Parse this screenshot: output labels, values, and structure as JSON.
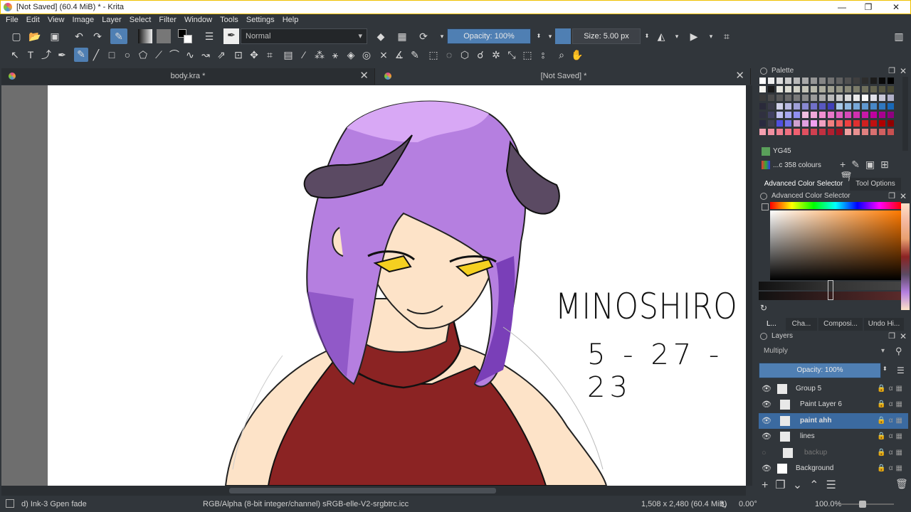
{
  "window": {
    "title": "[Not Saved]  (60.4 MiB)  * - Krita",
    "controls": [
      "—",
      "❐",
      "✕"
    ]
  },
  "menu": [
    {
      "label": "File",
      "u": "F"
    },
    {
      "label": "Edit",
      "u": "E"
    },
    {
      "label": "View",
      "u": "V"
    },
    {
      "label": "Image",
      "u": "I"
    },
    {
      "label": "Layer",
      "u": "L"
    },
    {
      "label": "Select",
      "u": "S"
    },
    {
      "label": "Filter",
      "u": "r"
    },
    {
      "label": "Window",
      "u": "W"
    },
    {
      "label": "Tools",
      "u": "T"
    },
    {
      "label": "Settings",
      "u": "S"
    },
    {
      "label": "Help",
      "u": "H"
    }
  ],
  "toolbar": {
    "blend_mode": "Normal",
    "opacity": "Opacity: 100%",
    "opacity_value": 1.0,
    "size": "Size: 5.00 px"
  },
  "tabs": [
    {
      "label": "body.kra *",
      "active": false
    },
    {
      "label": "[Not Saved]  *",
      "active": true
    }
  ],
  "canvas_text": {
    "name": "MINOSHIRO",
    "date": "5 - 27 - 23"
  },
  "status": {
    "brush": "d) Ink-3 Gpen fade",
    "color_space": "RGB/Alpha (8-bit integer/channel)  sRGB-elle-V2-srgbtrc.icc",
    "dimensions": "1,508 x 2,480 (60.4 MiB)",
    "rotation": "0.00°",
    "zoom": "100.0%"
  },
  "dock": {
    "palette_title": "Palette",
    "palette_color_name": "YG45",
    "palette_count": "...c 358 colours",
    "tabs_a": [
      "Advanced Color Selector",
      "Tool Options"
    ],
    "adv_title": "Advanced Color Selector",
    "tabs_b": [
      "L...",
      "Cha...",
      "Composi...",
      "Undo Hi..."
    ],
    "layers_title": "Layers",
    "layer_blend": "Multiply",
    "layer_opacity": "Opacity:  100%",
    "layers": [
      {
        "name": "Group 5",
        "selected": false,
        "visible": true
      },
      {
        "name": "Paint Layer 6",
        "selected": false,
        "visible": true
      },
      {
        "name": "paint ahh",
        "selected": true,
        "visible": true
      },
      {
        "name": "lines",
        "selected": false,
        "visible": true
      },
      {
        "name": "backup",
        "selected": false,
        "visible": false
      },
      {
        "name": "Background",
        "selected": false,
        "visible": true
      }
    ]
  },
  "colors": {
    "accent": "#3b6aa0",
    "hair": "#b57fe0",
    "hair_shadow": "#7a3fb8",
    "skin": "#fde3c8",
    "sweater": "#8b2323",
    "horn": "#5b4a63"
  }
}
